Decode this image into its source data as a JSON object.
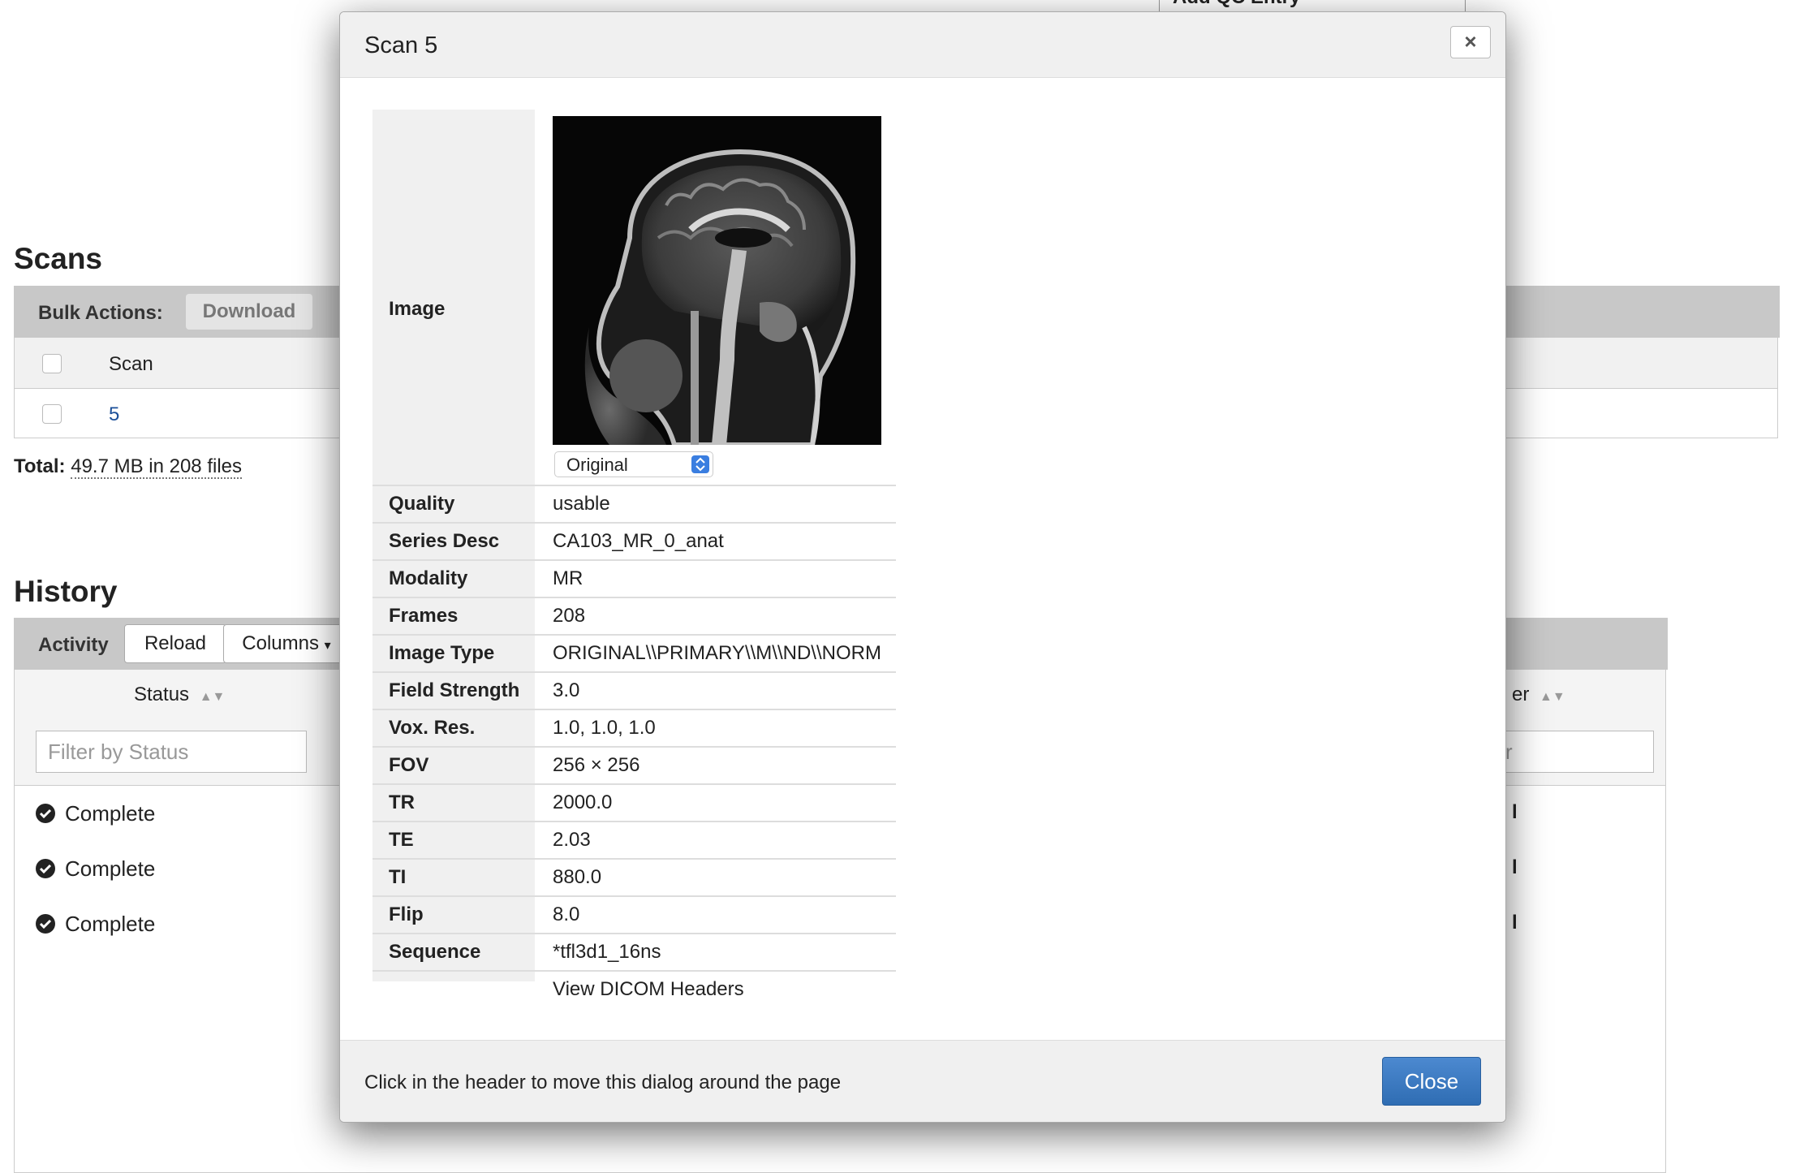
{
  "background": {
    "qc_tab_label": "Add QC Entry",
    "scans": {
      "heading": "Scans",
      "bulk_actions_label": "Bulk Actions:",
      "download_label": "Download",
      "column_scan": "Scan",
      "rows": [
        {
          "scan": "5"
        }
      ],
      "total_label": "Total:",
      "total_value": "49.7 MB in 208 files"
    },
    "history": {
      "heading": "History",
      "activity_label": "Activity",
      "reload_label": "Reload",
      "columns_label": "Columns",
      "column_status": "Status",
      "column_right_partial": "er",
      "filter_status_placeholder": "Filter by Status",
      "filter_right_partial": "r",
      "rows": [
        {
          "status": "Complete",
          "right_partial": "l"
        },
        {
          "status": "Complete",
          "right_partial": "l"
        },
        {
          "status": "Complete",
          "right_partial": "l"
        }
      ]
    }
  },
  "modal": {
    "title": "Scan 5",
    "close_x": "×",
    "image_label": "Image",
    "image_select_value": "Original",
    "fields": [
      {
        "label": "Quality",
        "value": "usable"
      },
      {
        "label": "Series Desc",
        "value": "CA103_MR_0_anat"
      },
      {
        "label": "Modality",
        "value": "MR"
      },
      {
        "label": "Frames",
        "value": "208"
      },
      {
        "label": "Image Type",
        "value": "ORIGINAL\\\\PRIMARY\\\\M\\\\ND\\\\NORM"
      },
      {
        "label": "Field Strength",
        "value": "3.0"
      },
      {
        "label": "Vox. Res.",
        "value": "1.0, 1.0, 1.0"
      },
      {
        "label": "FOV",
        "value": "256 × 256"
      },
      {
        "label": "TR",
        "value": "2000.0"
      },
      {
        "label": "TE",
        "value": "2.03"
      },
      {
        "label": "TI",
        "value": "880.0"
      },
      {
        "label": "Flip",
        "value": "8.0"
      },
      {
        "label": "Sequence",
        "value": "*tfl3d1_16ns"
      }
    ],
    "dicom_link": "View DICOM Headers",
    "footer_text": "Click in the header to move this dialog around the page",
    "close_button": "Close"
  },
  "colors": {
    "link": "#1b4f99",
    "primary_button": "#2f6db3",
    "toolbar_grey": "#c8c8c8"
  }
}
